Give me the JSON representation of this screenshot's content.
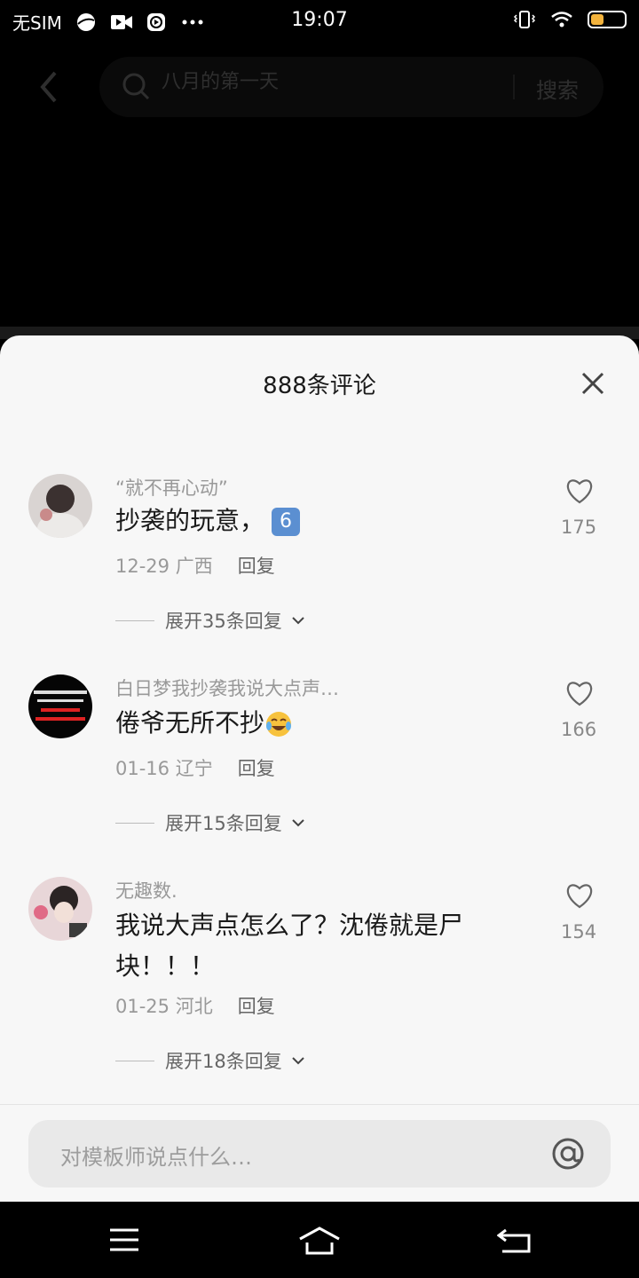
{
  "status_bar": {
    "carrier": "无SIM",
    "time": "19:07",
    "battery_color": "#f3b33d"
  },
  "header": {
    "search_placeholder": "八月的第一天",
    "search_button": "搜索"
  },
  "sheet": {
    "title": "888条评论",
    "comments": [
      {
        "name": "“就不再心动”",
        "text": "抄袭的玩意，",
        "emoji": "6",
        "date": "12-29",
        "location": "广西",
        "reply_label": "回复",
        "likes": "175",
        "expand": "展开35条回复"
      },
      {
        "name": "白日梦我抄袭我说大点声…",
        "text": "倦爷无所不抄",
        "date": "01-16",
        "location": "辽宁",
        "reply_label": "回复",
        "likes": "166",
        "expand": "展开15条回复"
      },
      {
        "name": "无趣数.",
        "text_line1": "我说大声点怎么了？沈倦就是尸",
        "text_line2": "块！！！",
        "date": "01-25",
        "location": "河北",
        "reply_label": "回复",
        "likes": "154",
        "expand": "展开18条回复"
      }
    ],
    "input_placeholder": "对模板师说点什么…"
  }
}
